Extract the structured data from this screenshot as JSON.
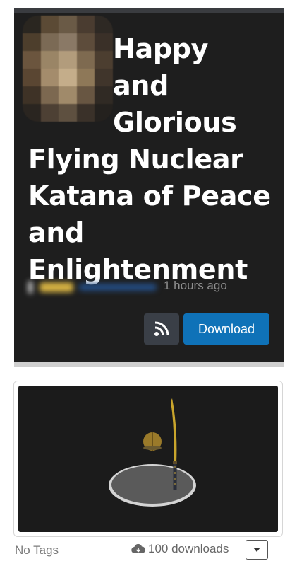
{
  "header": {
    "title_line1": "Happy",
    "title_line2": "and",
    "title_line3": "Glorious",
    "title_rest": "Flying Nuclear Katana of Peace and Enlightenment",
    "time_ago": "1 hours ago",
    "rss_icon": "rss-feed-icon",
    "download_label": "Download"
  },
  "footer": {
    "tags_label": "No Tags",
    "downloads_label": "100 downloads",
    "download_icon": "cloud-download-icon",
    "dropdown_icon": "caret-down-icon"
  },
  "colors": {
    "card_bg": "#1e1e1e",
    "download_button": "#0f72b8",
    "rss_button": "#3a3f47"
  }
}
